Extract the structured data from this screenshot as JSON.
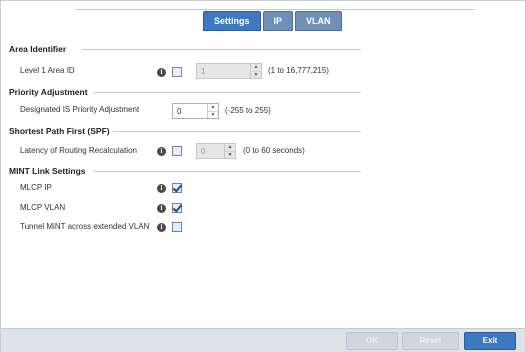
{
  "tabs": [
    {
      "label": "Settings",
      "active": true
    },
    {
      "label": "IP",
      "active": false
    },
    {
      "label": "VLAN",
      "active": false
    }
  ],
  "area_identifier": {
    "title": "Area Identifier",
    "level1_label": "Level 1 Area ID",
    "level1_value": "1",
    "level1_range": "(1 to 16,777,215)"
  },
  "priority_adjustment": {
    "title": "Priority Adjustment",
    "dis_label": "Designated IS Priority Adjustment",
    "dis_value": "0",
    "dis_range": "(-255 to 255)"
  },
  "spf": {
    "title": "Shortest Path First (SPF)",
    "latency_label": "Latency of Routing Recalculation",
    "latency_value": "0",
    "latency_range": "(0 to 60 seconds)"
  },
  "mint": {
    "title": "MINT Link Settings",
    "mlcp_ip_label": "MLCP IP",
    "mlcp_vlan_label": "MLCP VLAN",
    "tunnel_label": "Tunnel MiNT across extended VLAN"
  },
  "footer": {
    "ok": "OK",
    "reset": "Reset",
    "exit": "Exit"
  },
  "info_glyph": "i"
}
